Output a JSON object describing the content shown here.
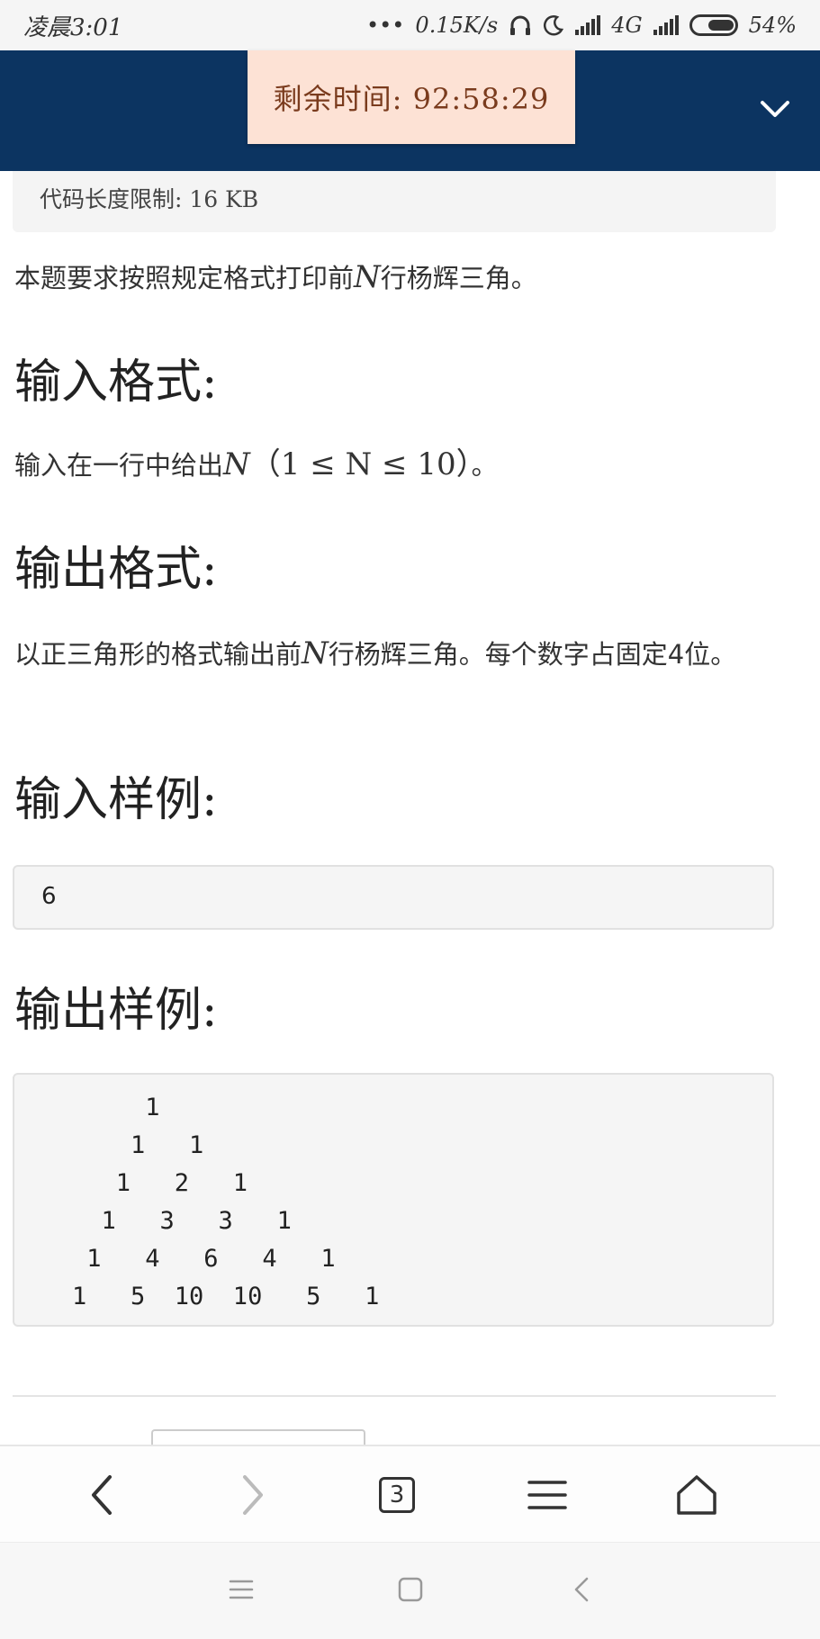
{
  "status_bar": {
    "time": "凌晨3:01",
    "dots": "•••",
    "speed": "0.15K/s",
    "network": "4G",
    "battery": "54%"
  },
  "header": {
    "timer_label": "剩余时间: 92:58:29"
  },
  "problem": {
    "code_limit": "代码长度限制: 16 KB",
    "statement_prefix": "本题要求按照规定格式打印前",
    "statement_var": "N",
    "statement_suffix": "行杨辉三角。",
    "input_heading": "输入格式:",
    "input_prefix": "输入在一行中给出",
    "input_var": "N",
    "input_constraint": "（1 ≤ N ≤ 10）",
    "input_suffix": "。",
    "output_heading": "输出格式:",
    "output_prefix": "以正三角形的格式输出前",
    "output_var": "N",
    "output_suffix": "行杨辉三角。每个数字占固定4位。",
    "sample_input_heading": "输入样例:",
    "sample_input": "6",
    "sample_output_heading": "输出样例:",
    "sample_output": "     1\n    1   1\n   1   2   1\n  1   3   3   1\n 1   4   6   4   1\n1   5  10  10   5   1"
  },
  "browser_nav": {
    "tab_count": "3"
  },
  "colors": {
    "header_bg": "#0c3461",
    "timer_bg": "#fde2d5",
    "timer_text": "#7a3b1d"
  }
}
